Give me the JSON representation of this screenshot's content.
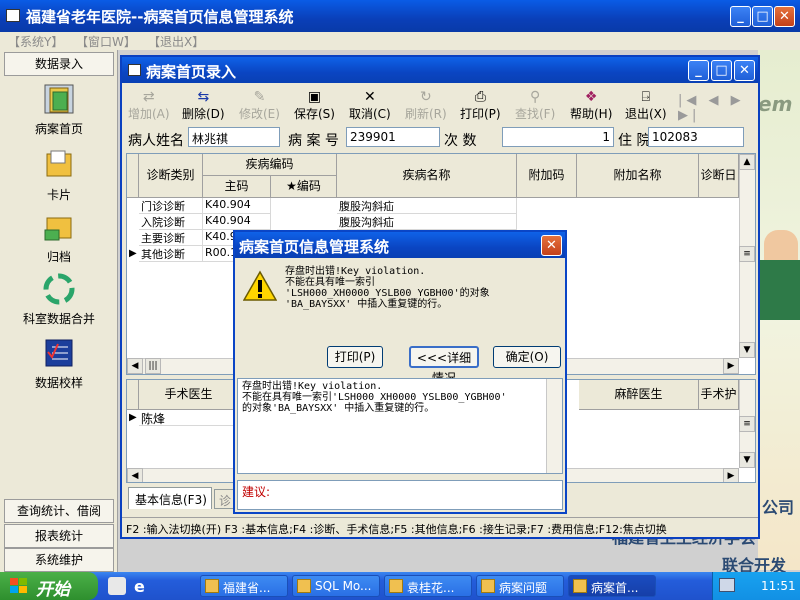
{
  "app": {
    "title": "福建省老年医院--病案首页信息管理系统",
    "menu": [
      "【系统Y】",
      "【窗口W】",
      "【退出X】"
    ]
  },
  "nav": {
    "header": "数据录入",
    "items": [
      {
        "label": "病案首页",
        "icon": "folder-record-icon"
      },
      {
        "label": "卡片",
        "icon": "card-folder-icon"
      },
      {
        "label": "归档",
        "icon": "archive-icon"
      },
      {
        "label": "科室数据合并",
        "icon": "recycle-merge-icon"
      },
      {
        "label": "数据校样",
        "icon": "checklist-icon"
      }
    ],
    "bottom": [
      "查询统计、借阅",
      "报表统计",
      "系统维护"
    ]
  },
  "inner": {
    "title": "病案首页录入",
    "toolbar": [
      {
        "label": "增加(A)",
        "enabled": false
      },
      {
        "label": "删除(D)",
        "enabled": true
      },
      {
        "label": "修改(E)",
        "enabled": false
      },
      {
        "label": "保存(S)",
        "enabled": true
      },
      {
        "label": "取消(C)",
        "enabled": true
      },
      {
        "label": "刷新(R)",
        "enabled": false
      },
      {
        "label": "打印(P)",
        "enabled": true
      },
      {
        "label": "查找(F)",
        "enabled": false
      },
      {
        "label": "帮助(H)",
        "enabled": true
      },
      {
        "label": "退出(X)",
        "enabled": true
      }
    ],
    "fields": {
      "patient_name_label": "病人姓名",
      "patient_name": "林兆祺",
      "record_no_label": "病 案 号",
      "record_no": "239901",
      "times_label": "次    数",
      "times": "1",
      "admission_no_label": "住 院 号",
      "admission_no": "102083"
    },
    "diag_grid": {
      "headers": {
        "type": "诊断类别",
        "code_group": "疾病编码",
        "main_code": "主码",
        "star_code": "★编码",
        "name": "疾病名称",
        "extra_code": "附加码",
        "extra_name": "附加名称",
        "date": "诊断日"
      },
      "rows": [
        {
          "type": "门诊诊断",
          "code": "K40.904",
          "name": "腹股沟斜疝"
        },
        {
          "type": "入院诊断",
          "code": "K40.904",
          "name": "腹股沟斜疝"
        },
        {
          "type": "主要诊断",
          "code": "K40.9",
          "name": ""
        },
        {
          "type": "其他诊断",
          "code": "R00.1",
          "name": ""
        }
      ]
    },
    "surgery_grid": {
      "headers": {
        "surgeon": "手术医生",
        "anesthetist": "麻醉医生",
        "nurse": "手术护"
      },
      "rows": [
        {
          "surgeon": "陈烽"
        }
      ]
    },
    "tabs": [
      "基本信息(F3)",
      "诊"
    ],
    "statusbar": "F2 :输入法切换(开)  F3 :基本信息;F4 :诊断、手术信息;F5 :其他信息;F6 :接生记录;F7 :费用信息;F12:焦点切换"
  },
  "dialog": {
    "title": "病案首页信息管理系统",
    "message": [
      "存盘时出错!Key violation.",
      "不能在具有唯一索引",
      "'LSH000_XH0000_YSLB00_YGBH00'的对象",
      "'BA_BAYSXX' 中插入重复键的行。"
    ],
    "buttons": [
      "打印(P)",
      "<<<详细情况",
      "确定(O)"
    ],
    "details": [
      "存盘时出错!Key violation.",
      "不能在具有唯一索引'LSH000_XH0000_YSLB00_YGBH00'",
      "的对象'BA_BAYSXX' 中插入重复键的行。"
    ],
    "suggestion_label": "建议:",
    "suggestion": ""
  },
  "background_text": {
    "em": "em",
    "company": "公司",
    "org": "福建省卫生经济学会",
    "dev": "联合开发"
  },
  "taskbar": {
    "start": "开始",
    "tasks": [
      "福建省...",
      "SQL Mo...",
      "袁桂花...",
      "病案问题",
      "病案首..."
    ],
    "clock": "11:51"
  },
  "colors": {
    "titlebar": "#0a45c2",
    "close": "#d9542a",
    "taskbar": "#245ddb",
    "start": "#3a9c3a"
  }
}
